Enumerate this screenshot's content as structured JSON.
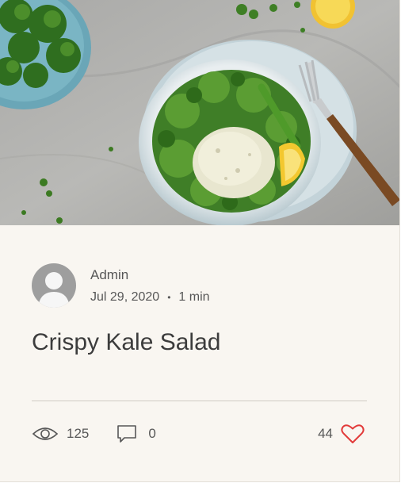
{
  "post": {
    "image_alt": "Crispy kale salad bowl with lemon and fork",
    "author": "Admin",
    "date": "Jul 29, 2020",
    "separator": "•",
    "read_time": "1 min",
    "title": "Crispy Kale Salad",
    "views": "125",
    "comments": "0",
    "likes": "44"
  },
  "icons": {
    "avatar": "avatar-placeholder-icon",
    "views": "eye-icon",
    "comments": "comment-bubble-icon",
    "like": "heart-icon"
  },
  "colors": {
    "card_background": "#f9f6f1",
    "text": "#575757",
    "title": "#3c3c3c",
    "heart": "#e23a3a",
    "avatar": "#9e9e9e"
  }
}
